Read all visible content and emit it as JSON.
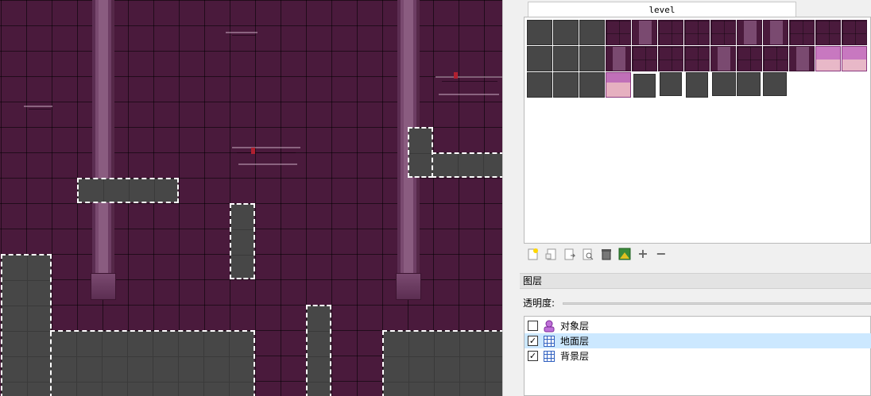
{
  "tileset": {
    "tab_label": "level",
    "toolbar": [
      {
        "name": "new-tileset-icon"
      },
      {
        "name": "import-tileset-icon"
      },
      {
        "name": "export-tileset-icon"
      },
      {
        "name": "tileset-properties-icon"
      },
      {
        "name": "delete-tileset-icon"
      },
      {
        "name": "edit-terrain-icon"
      },
      {
        "name": "add-tiles-icon",
        "glyph": "+"
      },
      {
        "name": "remove-tiles-icon",
        "glyph": "−"
      }
    ]
  },
  "layers": {
    "title": "图层",
    "opacity_label": "透明度:",
    "items": [
      {
        "name": "对象层",
        "visible": false,
        "type": "object",
        "selected": false
      },
      {
        "name": "地面层",
        "visible": true,
        "type": "tile",
        "selected": true
      },
      {
        "name": "背景层",
        "visible": true,
        "type": "tile",
        "selected": false
      }
    ]
  },
  "colors": {
    "map_background": "#4a1a3c",
    "solid_tile": "#474747",
    "selection_outline": "#ffffff",
    "selected_layer": "#cce8ff",
    "object_layer_icon": "#b050c8",
    "tile_layer_icon": "#3060c0"
  }
}
